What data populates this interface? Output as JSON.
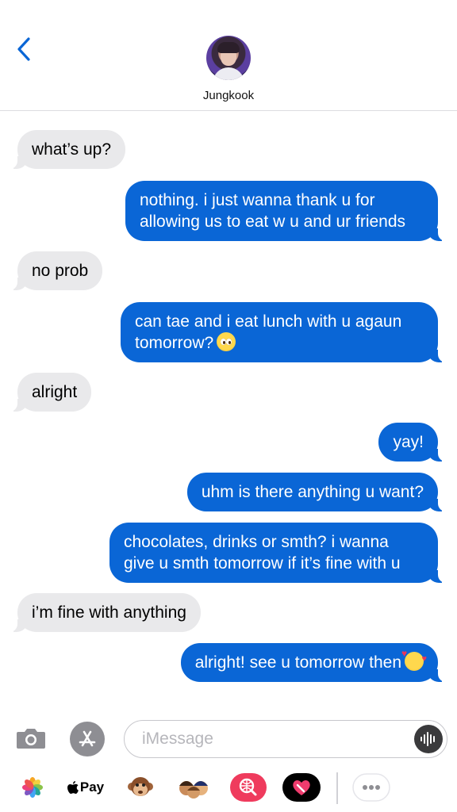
{
  "header": {
    "contact_name": "Jungkook",
    "back_icon": "chevron-left-icon"
  },
  "messages": [
    {
      "side": "in",
      "text": "what’s up?"
    },
    {
      "side": "out",
      "lines": [
        "nothing. i just wanna thank u for",
        "allowing us to eat w u and ur friends"
      ]
    },
    {
      "side": "in",
      "text": "no prob"
    },
    {
      "side": "out",
      "lines": [
        "can tae and i eat lunch with u agaun",
        "tomorrow?"
      ],
      "emoji": "pleading-face-emoji"
    },
    {
      "side": "in",
      "text": "alright"
    },
    {
      "side": "out",
      "text": "yay!"
    },
    {
      "side": "out",
      "text": "uhm is there anything u want?"
    },
    {
      "side": "out",
      "lines": [
        "chocolates, drinks or smth? i wanna",
        "give u smth tomorrow if it’s fine with u"
      ]
    },
    {
      "side": "in",
      "text": "i’m fine with anything"
    },
    {
      "side": "out",
      "text": "alright! see u tomorrow then",
      "emoji": "smiling-face-with-hearts-emoji"
    }
  ],
  "input": {
    "placeholder": "iMessage",
    "value": ""
  },
  "drawer": {
    "apple_pay_label": "Pay"
  },
  "colors": {
    "outgoing_bubble": "#0a66d6",
    "incoming_bubble": "#e9e9eb",
    "accent": "#0a66d6"
  }
}
